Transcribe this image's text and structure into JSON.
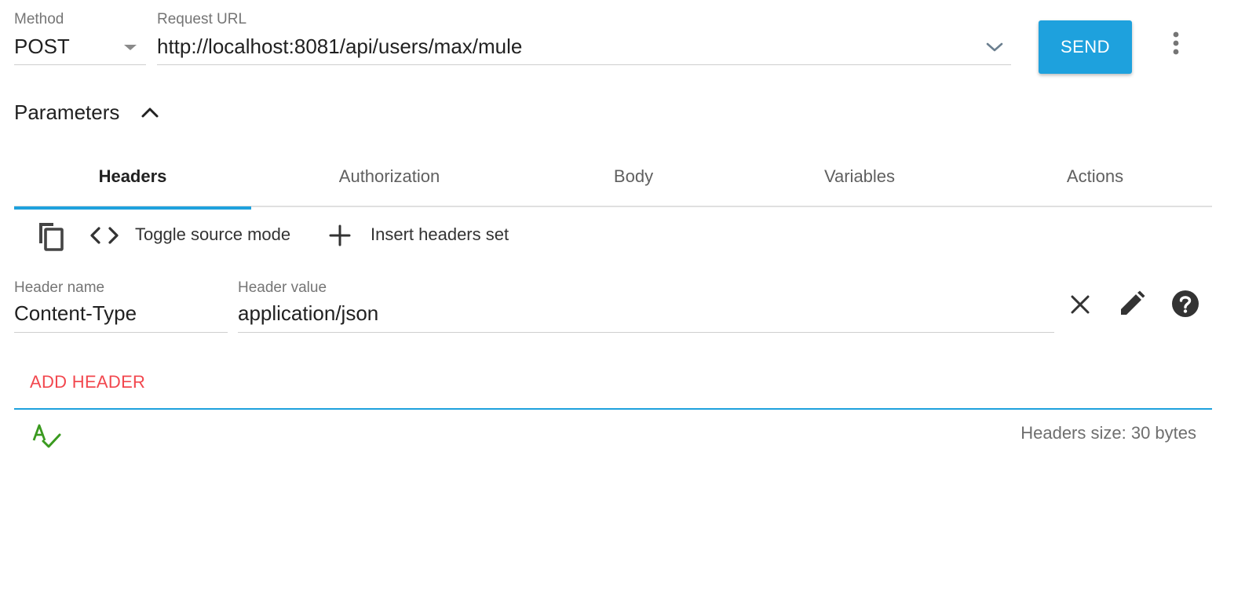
{
  "request": {
    "method_label": "Method",
    "method_value": "POST",
    "url_label": "Request URL",
    "url_value": "http://localhost:8081/api/users/max/mule",
    "send_label": "SEND"
  },
  "parameters": {
    "title": "Parameters"
  },
  "tabs": [
    {
      "label": "Headers",
      "active": true
    },
    {
      "label": "Authorization",
      "active": false
    },
    {
      "label": "Body",
      "active": false
    },
    {
      "label": "Variables",
      "active": false
    },
    {
      "label": "Actions",
      "active": false
    }
  ],
  "toolbar": {
    "toggle_label": "Toggle source mode",
    "insert_label": "Insert headers set"
  },
  "header_row": {
    "name_label": "Header name",
    "name_value": "Content-Type",
    "value_label": "Header value",
    "value_value": "application/json"
  },
  "add_header_label": "ADD HEADER",
  "status": {
    "size_text": "Headers size: 30 bytes"
  },
  "colors": {
    "accent": "#1ea1dd",
    "add_header": "#f2474e",
    "spellcheck": "#3a9a1f"
  },
  "icons": {
    "method_dropdown": "caret-down-icon",
    "url_dropdown": "chevron-down-icon",
    "more": "more-vert-icon",
    "collapse": "chevron-up-icon",
    "copy": "copy-icon",
    "code": "code-icon",
    "add": "plus-icon",
    "remove": "close-icon",
    "edit": "pencil-icon",
    "help": "help-icon",
    "spellcheck": "spellcheck-icon"
  }
}
